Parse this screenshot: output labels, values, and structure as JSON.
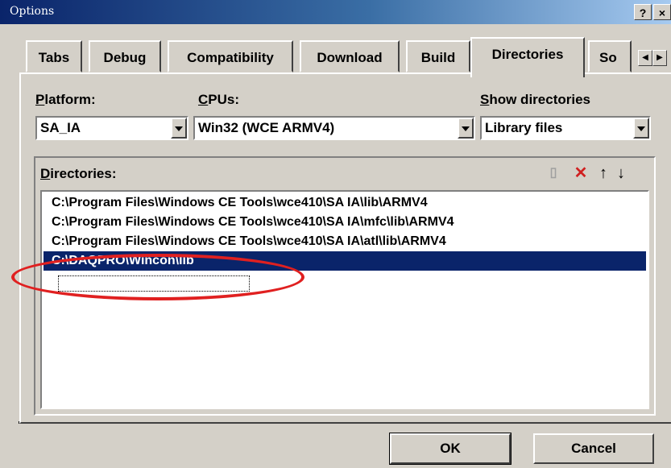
{
  "window": {
    "title": "Options",
    "help_label": "?",
    "close_label": "×"
  },
  "tabs": [
    "Tabs",
    "Debug",
    "Compatibility",
    "Download",
    "Build",
    "Directories",
    "So"
  ],
  "active_tab": "Directories",
  "platform": {
    "label_ul": "P",
    "label_rest": "latform:",
    "value": "SA_IA"
  },
  "cpus": {
    "label_ul": "C",
    "label_rest": "PUs:",
    "value": "Win32 (WCE ARMV4)"
  },
  "show_dirs": {
    "label_ul": "S",
    "label_rest": "how directories",
    "value": "Library files"
  },
  "directories": {
    "label_ul": "D",
    "label_rest": "irectories:",
    "items": [
      "C:\\Program Files\\Windows CE Tools\\wce410\\SA  IA\\lib\\ARMV4",
      "C:\\Program Files\\Windows CE Tools\\wce410\\SA  IA\\mfc\\lib\\ARMV4",
      "C:\\Program Files\\Windows CE Tools\\wce410\\SA  IA\\atl\\lib\\ARMV4",
      "C:\\DAQPRO\\Wincon\\lib"
    ],
    "selected_index": 3
  },
  "toolbar": {
    "new_icon": "new-folder-icon",
    "delete_icon": "delete-icon",
    "up_icon": "move-up-icon",
    "down_icon": "move-down-icon"
  },
  "buttons": {
    "ok": "OK",
    "cancel": "Cancel"
  },
  "colors": {
    "selection": "#0a246a",
    "annotation": "#e02020"
  }
}
